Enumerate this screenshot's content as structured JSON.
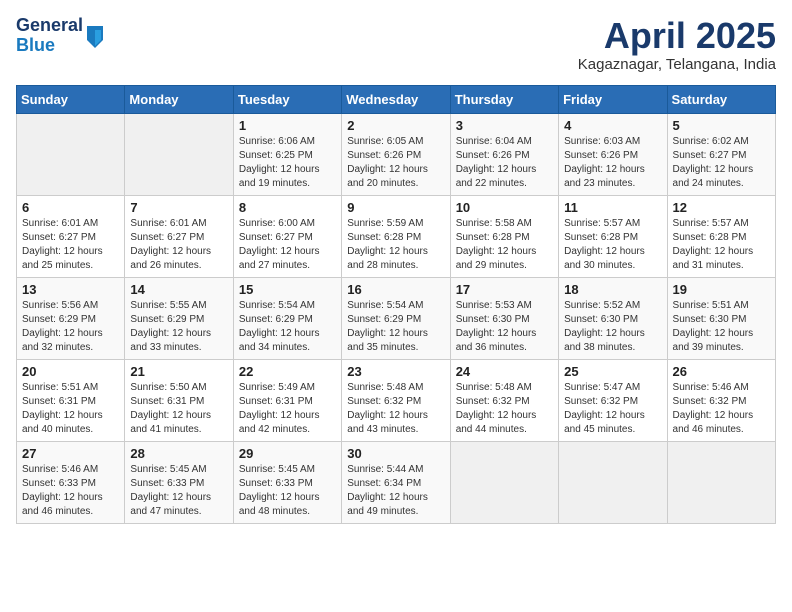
{
  "header": {
    "logo_line1": "General",
    "logo_line2": "Blue",
    "month_title": "April 2025",
    "subtitle": "Kagaznagar, Telangana, India"
  },
  "days_of_week": [
    "Sunday",
    "Monday",
    "Tuesday",
    "Wednesday",
    "Thursday",
    "Friday",
    "Saturday"
  ],
  "weeks": [
    [
      {
        "day": "",
        "info": ""
      },
      {
        "day": "",
        "info": ""
      },
      {
        "day": "1",
        "info": "Sunrise: 6:06 AM\nSunset: 6:25 PM\nDaylight: 12 hours and 19 minutes."
      },
      {
        "day": "2",
        "info": "Sunrise: 6:05 AM\nSunset: 6:26 PM\nDaylight: 12 hours and 20 minutes."
      },
      {
        "day": "3",
        "info": "Sunrise: 6:04 AM\nSunset: 6:26 PM\nDaylight: 12 hours and 22 minutes."
      },
      {
        "day": "4",
        "info": "Sunrise: 6:03 AM\nSunset: 6:26 PM\nDaylight: 12 hours and 23 minutes."
      },
      {
        "day": "5",
        "info": "Sunrise: 6:02 AM\nSunset: 6:27 PM\nDaylight: 12 hours and 24 minutes."
      }
    ],
    [
      {
        "day": "6",
        "info": "Sunrise: 6:01 AM\nSunset: 6:27 PM\nDaylight: 12 hours and 25 minutes."
      },
      {
        "day": "7",
        "info": "Sunrise: 6:01 AM\nSunset: 6:27 PM\nDaylight: 12 hours and 26 minutes."
      },
      {
        "day": "8",
        "info": "Sunrise: 6:00 AM\nSunset: 6:27 PM\nDaylight: 12 hours and 27 minutes."
      },
      {
        "day": "9",
        "info": "Sunrise: 5:59 AM\nSunset: 6:28 PM\nDaylight: 12 hours and 28 minutes."
      },
      {
        "day": "10",
        "info": "Sunrise: 5:58 AM\nSunset: 6:28 PM\nDaylight: 12 hours and 29 minutes."
      },
      {
        "day": "11",
        "info": "Sunrise: 5:57 AM\nSunset: 6:28 PM\nDaylight: 12 hours and 30 minutes."
      },
      {
        "day": "12",
        "info": "Sunrise: 5:57 AM\nSunset: 6:28 PM\nDaylight: 12 hours and 31 minutes."
      }
    ],
    [
      {
        "day": "13",
        "info": "Sunrise: 5:56 AM\nSunset: 6:29 PM\nDaylight: 12 hours and 32 minutes."
      },
      {
        "day": "14",
        "info": "Sunrise: 5:55 AM\nSunset: 6:29 PM\nDaylight: 12 hours and 33 minutes."
      },
      {
        "day": "15",
        "info": "Sunrise: 5:54 AM\nSunset: 6:29 PM\nDaylight: 12 hours and 34 minutes."
      },
      {
        "day": "16",
        "info": "Sunrise: 5:54 AM\nSunset: 6:29 PM\nDaylight: 12 hours and 35 minutes."
      },
      {
        "day": "17",
        "info": "Sunrise: 5:53 AM\nSunset: 6:30 PM\nDaylight: 12 hours and 36 minutes."
      },
      {
        "day": "18",
        "info": "Sunrise: 5:52 AM\nSunset: 6:30 PM\nDaylight: 12 hours and 38 minutes."
      },
      {
        "day": "19",
        "info": "Sunrise: 5:51 AM\nSunset: 6:30 PM\nDaylight: 12 hours and 39 minutes."
      }
    ],
    [
      {
        "day": "20",
        "info": "Sunrise: 5:51 AM\nSunset: 6:31 PM\nDaylight: 12 hours and 40 minutes."
      },
      {
        "day": "21",
        "info": "Sunrise: 5:50 AM\nSunset: 6:31 PM\nDaylight: 12 hours and 41 minutes."
      },
      {
        "day": "22",
        "info": "Sunrise: 5:49 AM\nSunset: 6:31 PM\nDaylight: 12 hours and 42 minutes."
      },
      {
        "day": "23",
        "info": "Sunrise: 5:48 AM\nSunset: 6:32 PM\nDaylight: 12 hours and 43 minutes."
      },
      {
        "day": "24",
        "info": "Sunrise: 5:48 AM\nSunset: 6:32 PM\nDaylight: 12 hours and 44 minutes."
      },
      {
        "day": "25",
        "info": "Sunrise: 5:47 AM\nSunset: 6:32 PM\nDaylight: 12 hours and 45 minutes."
      },
      {
        "day": "26",
        "info": "Sunrise: 5:46 AM\nSunset: 6:32 PM\nDaylight: 12 hours and 46 minutes."
      }
    ],
    [
      {
        "day": "27",
        "info": "Sunrise: 5:46 AM\nSunset: 6:33 PM\nDaylight: 12 hours and 46 minutes."
      },
      {
        "day": "28",
        "info": "Sunrise: 5:45 AM\nSunset: 6:33 PM\nDaylight: 12 hours and 47 minutes."
      },
      {
        "day": "29",
        "info": "Sunrise: 5:45 AM\nSunset: 6:33 PM\nDaylight: 12 hours and 48 minutes."
      },
      {
        "day": "30",
        "info": "Sunrise: 5:44 AM\nSunset: 6:34 PM\nDaylight: 12 hours and 49 minutes."
      },
      {
        "day": "",
        "info": ""
      },
      {
        "day": "",
        "info": ""
      },
      {
        "day": "",
        "info": ""
      }
    ]
  ]
}
